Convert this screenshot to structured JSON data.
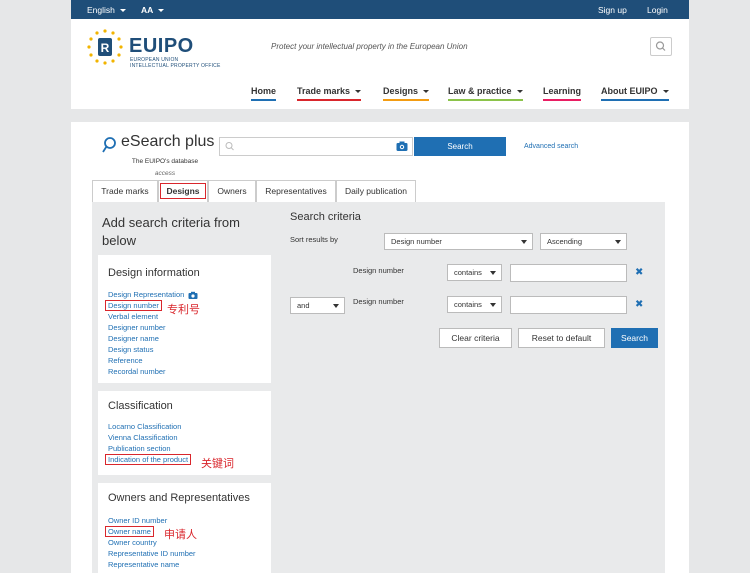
{
  "topbar": {
    "language": "English",
    "font_size": "AA",
    "signup": "Sign up",
    "login": "Login"
  },
  "header": {
    "logo_text": "EUIPO",
    "logo_sub_1": "EUROPEAN UNION",
    "logo_sub_2": "INTELLECTUAL PROPERTY OFFICE",
    "tagline": "Protect your intellectual property in the European Union",
    "nav": [
      {
        "label": "Home",
        "color": "#1f6fb3"
      },
      {
        "label": "Trade marks",
        "color": "#d9262c"
      },
      {
        "label": "Designs",
        "color": "#f39c12"
      },
      {
        "label": "Law & practice",
        "color": "#8bc34a"
      },
      {
        "label": "Learning",
        "color": "#e91e63"
      },
      {
        "label": "About EUIPO",
        "color": "#1f6fb3"
      }
    ]
  },
  "esearch": {
    "title": "eSearch plus",
    "subtitle": "The EUIPO's database",
    "subtitle2": "access",
    "search_button": "Search",
    "advanced": "Advanced search"
  },
  "tabs": [
    "Trade marks",
    "Designs",
    "Owners",
    "Representatives",
    "Daily publication"
  ],
  "left": {
    "heading": "Add search criteria from below",
    "design_info": {
      "title": "Design information",
      "links": [
        "Design Representation",
        "Design number",
        "Verbal element",
        "Designer number",
        "Designer name",
        "Design status",
        "Reference",
        "Recordal number"
      ]
    },
    "classification": {
      "title": "Classification",
      "links": [
        "Locarno Classification",
        "Vienna Classification",
        "Publication section",
        "Indication of the product"
      ]
    },
    "owners": {
      "title": "Owners and Representatives",
      "links": [
        "Owner ID number",
        "Owner name",
        "Owner country",
        "Representative ID number",
        "Representative name"
      ]
    },
    "annotations": {
      "design_number": "专利号",
      "indication": "关键词",
      "owner_name": "申请人"
    }
  },
  "right": {
    "title": "Search criteria",
    "sort_label": "Sort results by",
    "sort_field": "Design number",
    "sort_order": "Ascending",
    "row1_label": "Design number",
    "row1_op": "contains",
    "row2_conj": "and",
    "row2_label": "Design number",
    "row2_op": "contains",
    "clear": "Clear criteria",
    "reset": "Reset to default",
    "search": "Search"
  }
}
